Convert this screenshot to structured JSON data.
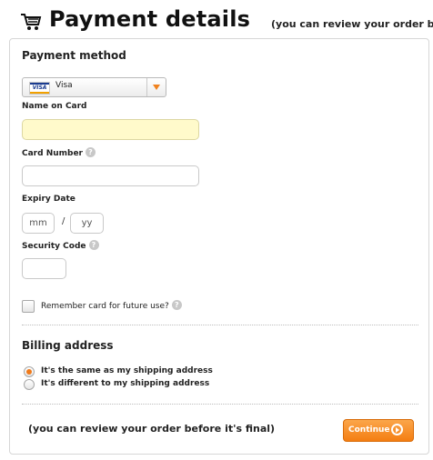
{
  "header": {
    "cart_icon": "shopping-cart-icon",
    "title": "Payment details",
    "subtitle": "(you can review your order before it's final)"
  },
  "payment_method": {
    "title": "Payment method",
    "card_logo_text": "VISA",
    "selected_card": "Visa"
  },
  "name_on_card": {
    "label": "Name on Card",
    "value": ""
  },
  "card_number": {
    "label": "Card Number",
    "value": ""
  },
  "expiry": {
    "label": "Expiry Date",
    "month_placeholder": "mm",
    "year_placeholder": "yy",
    "separator": "/"
  },
  "security_code": {
    "label": "Security Code",
    "value": ""
  },
  "help_icon_glyph": "?",
  "remember": {
    "label": "Remember card for future use?",
    "checked": false
  },
  "billing": {
    "title": "Billing address",
    "options": [
      {
        "label": "It's the same as my shipping address",
        "checked": true
      },
      {
        "label": "It's different to my shipping address",
        "checked": false
      }
    ]
  },
  "footer": {
    "review_text": "(you can review your order before it's final)",
    "continue_label": "Continue"
  },
  "colors": {
    "accent": "#f47e12",
    "highlight_field": "#fffacb"
  }
}
